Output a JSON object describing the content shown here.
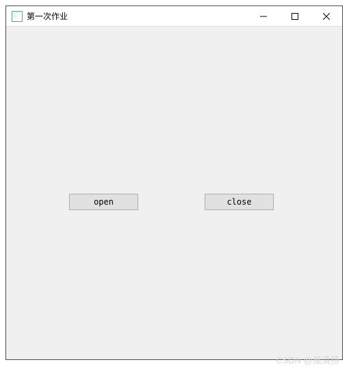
{
  "window": {
    "title": "第一次作业"
  },
  "buttons": {
    "open_label": "open",
    "close_label": "close"
  },
  "watermark": "CSDN @風清扬"
}
